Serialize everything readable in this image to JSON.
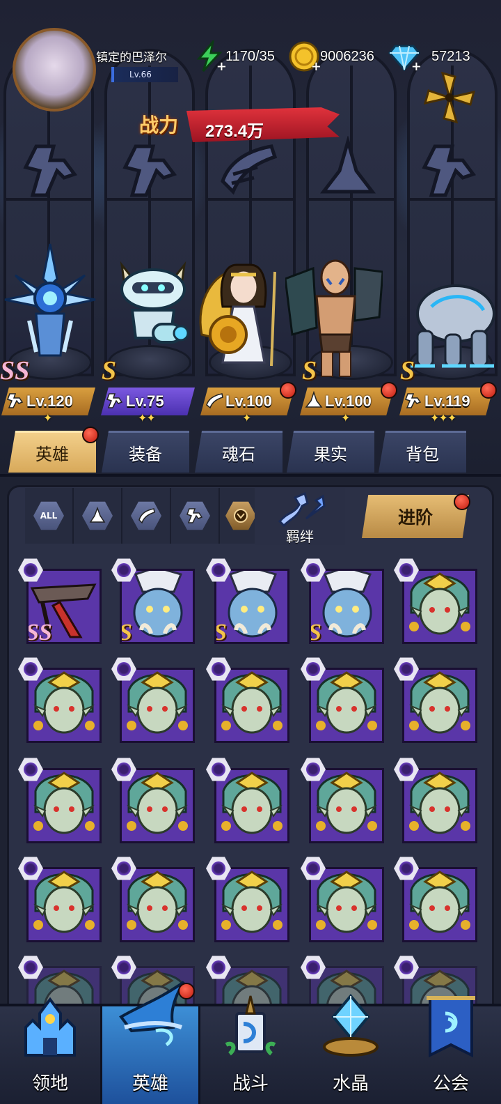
{
  "player": {
    "name": "镇定的巴泽尔",
    "level": "Lv.66"
  },
  "resources": {
    "energy": "1170/35",
    "gold": "9006236",
    "gems": "57213"
  },
  "combat_power": {
    "label": "战力",
    "value": "273.4万"
  },
  "team": [
    {
      "rank": "SS",
      "level": "Lv.120",
      "class": "wrench",
      "stars": "✦",
      "bar": "gold"
    },
    {
      "rank": "S",
      "level": "Lv.75",
      "class": "wrench",
      "stars": "✦✦",
      "bar": "purple"
    },
    {
      "rank": "",
      "level": "Lv.100",
      "class": "wing",
      "stars": "✦",
      "bar": "gold"
    },
    {
      "rank": "S",
      "level": "Lv.100",
      "class": "spire",
      "stars": "✦",
      "bar": "gold"
    },
    {
      "rank": "S",
      "level": "Lv.119",
      "class": "wrench",
      "stars": "✦✦✦",
      "bar": "gold"
    }
  ],
  "category_tabs": [
    "英雄",
    "装备",
    "魂石",
    "果实",
    "背包"
  ],
  "filters": {
    "all_label": "ALL",
    "bond_label": "羁绊",
    "advance_label": "进阶"
  },
  "hero_cards": [
    {
      "portrait": "mech",
      "rank": "SS"
    },
    {
      "portrait": "orc",
      "rank": "S"
    },
    {
      "portrait": "orc",
      "rank": "S"
    },
    {
      "portrait": "orc",
      "rank": "S"
    },
    {
      "portrait": "elf",
      "rank": ""
    }
  ],
  "bottom_nav": [
    {
      "label": "领地",
      "icon": "castle-icon"
    },
    {
      "label": "英雄",
      "icon": "wizard-hat-icon"
    },
    {
      "label": "战斗",
      "icon": "sword-icon"
    },
    {
      "label": "水晶",
      "icon": "crystal-icon"
    },
    {
      "label": "公会",
      "icon": "banner-icon"
    }
  ],
  "colors": {
    "accent_gold": "#d8a95a",
    "hero_card_purple": "#6a3fbf",
    "power_red": "#c21d22",
    "nav_active_blue": "#2f74c4"
  }
}
